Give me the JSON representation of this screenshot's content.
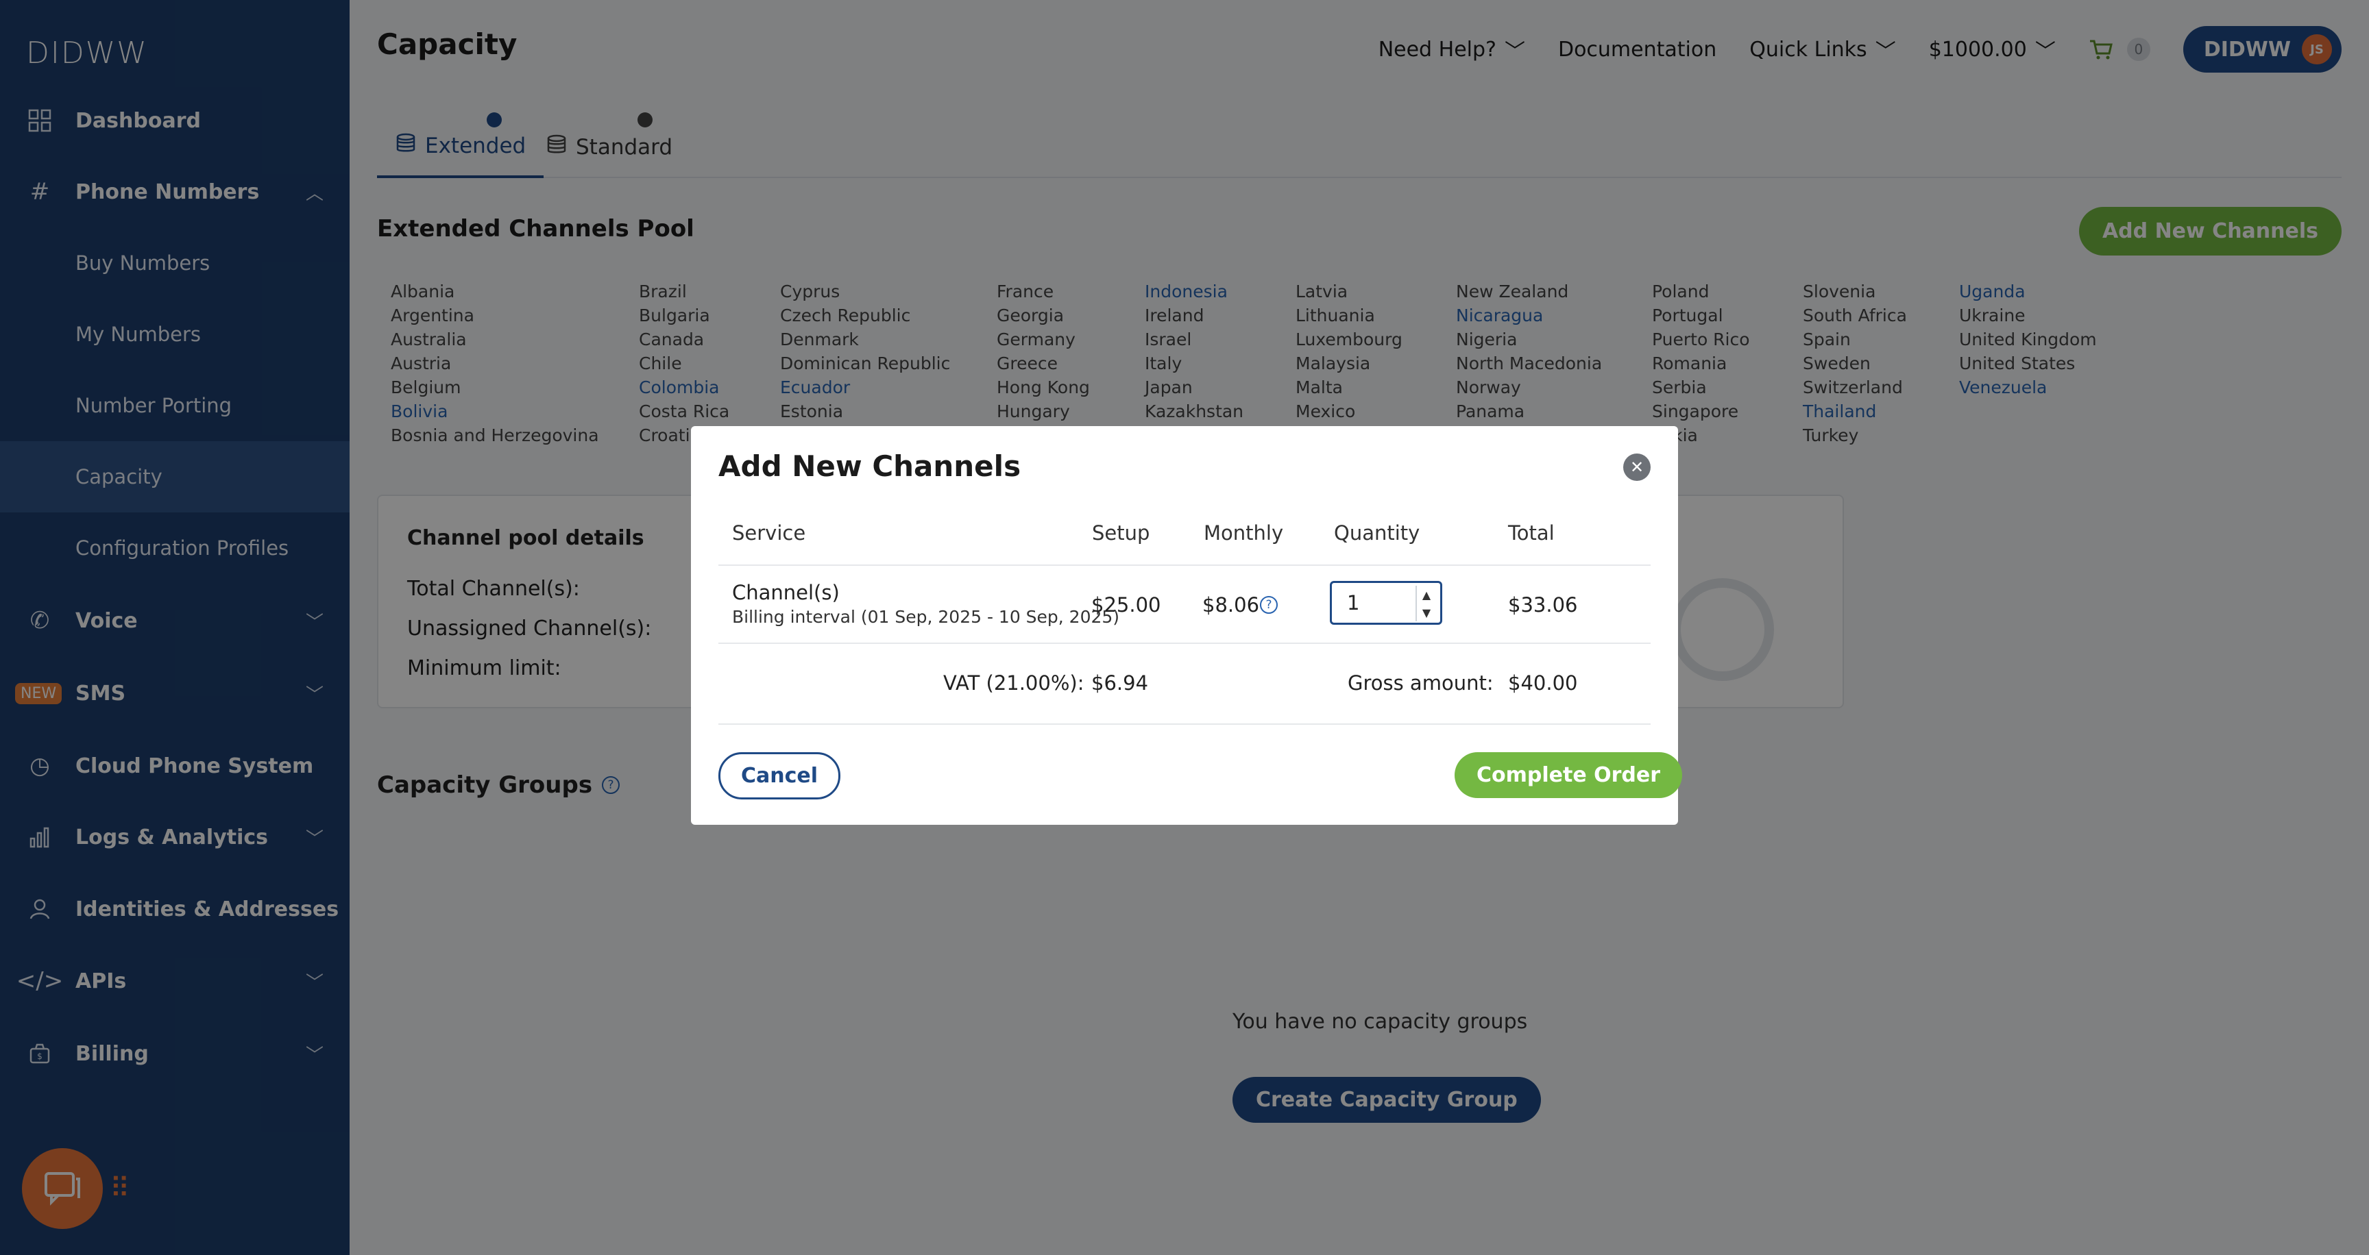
{
  "app": {
    "logo": "DIDWW"
  },
  "sidebar": {
    "items": [
      {
        "label": "Dashboard",
        "icon": "grid-icon"
      },
      {
        "label": "Phone Numbers",
        "icon": "hash-icon"
      },
      {
        "label": "Buy Numbers"
      },
      {
        "label": "My Numbers"
      },
      {
        "label": "Number Porting"
      },
      {
        "label": "Capacity"
      },
      {
        "label": "Configuration Profiles"
      },
      {
        "label": "Voice",
        "icon": "phone-icon"
      },
      {
        "label": "SMS",
        "badge": "NEW"
      },
      {
        "label": "Cloud Phone System",
        "icon": "clock-icon"
      },
      {
        "label": "Logs & Analytics",
        "icon": "bar-chart-icon"
      },
      {
        "label": "Identities & Addresses",
        "icon": "user-icon"
      },
      {
        "label": "APIs",
        "icon": "code-icon"
      },
      {
        "label": "Billing",
        "icon": "wallet-icon"
      }
    ]
  },
  "header": {
    "title": "Capacity",
    "help": "Need Help?",
    "documentation": "Documentation",
    "quick_links": "Quick Links",
    "balance": "$1000.00",
    "cart_count": "0",
    "account": "DIDWW",
    "avatar": "JS"
  },
  "tabs": [
    {
      "label": "Extended",
      "dot_color": "#1f4a86"
    },
    {
      "label": "Standard",
      "dot_color": "#444444"
    }
  ],
  "pool": {
    "title": "Extended Channels Pool",
    "add_button": "Add New Channels",
    "countries": [
      [
        "Albania",
        "Argentina",
        "Australia",
        "Austria",
        "Belgium",
        "Bolivia",
        "Bosnia and Herzegovina"
      ],
      [
        "Brazil",
        "Bulgaria",
        "Canada",
        "Chile",
        "Colombia",
        "Costa Rica",
        "Croati"
      ],
      [
        "Cyprus",
        "Czech Republic",
        "Denmark",
        "Dominican Republic",
        "Ecuador",
        "Estonia"
      ],
      [
        "France",
        "Georgia",
        "Germany",
        "Greece",
        "Hong Kong",
        "Hungary"
      ],
      [
        "Indonesia",
        "Ireland",
        "Israel",
        "Italy",
        "Japan",
        "Kazakhstan"
      ],
      [
        "Latvia",
        "Lithuania",
        "Luxembourg",
        "Malaysia",
        "Malta",
        "Mexico"
      ],
      [
        "New Zealand",
        "Nicaragua",
        "Nigeria",
        "North Macedonia",
        "Norway",
        "Panama"
      ],
      [
        "Poland",
        "Portugal",
        "Puerto Rico",
        "Romania",
        "Serbia",
        "Singapore",
        "vakia"
      ],
      [
        "Slovenia",
        "South Africa",
        "Spain",
        "Sweden",
        "Switzerland",
        "Thailand",
        "Turkey"
      ],
      [
        "Uganda",
        "Ukraine",
        "United Kingdom",
        "United States",
        "Venezuela"
      ]
    ],
    "link_countries": [
      "Bolivia",
      "Colombia",
      "Ecuador",
      "Indonesia",
      "Nicaragua",
      "Thailand",
      "Uganda",
      "Venezuela"
    ]
  },
  "details": {
    "title": "Channel pool details",
    "total": "Total Channel(s):",
    "unassigned": "Unassigned Channel(s):",
    "minimum": "Minimum limit:"
  },
  "groups": {
    "title": "Capacity Groups",
    "empty": "You have no capacity groups",
    "create_button": "Create Capacity Group"
  },
  "modal": {
    "title": "Add New Channels",
    "columns": {
      "service": "Service",
      "setup": "Setup",
      "monthly": "Monthly",
      "quantity": "Quantity",
      "total": "Total"
    },
    "row": {
      "service": "Channel(s)",
      "billing": "Billing interval (01 Sep, 2025 - 10 Sep, 2025)",
      "setup": "$25.00",
      "monthly": "$8.06",
      "quantity": "1",
      "total": "$33.06"
    },
    "vat_label": "VAT (21.00%):",
    "vat_value": "$6.94",
    "gross_label": "Gross amount:",
    "gross_value": "$40.00",
    "cancel": "Cancel",
    "complete": "Complete Order"
  }
}
